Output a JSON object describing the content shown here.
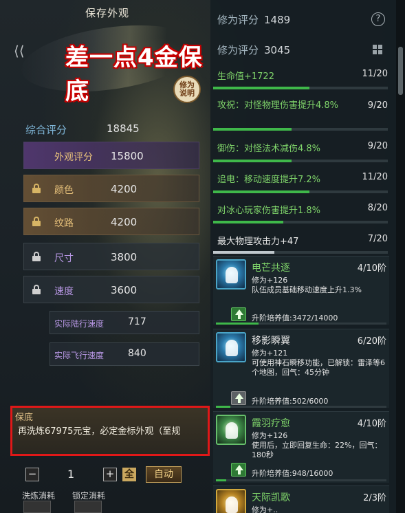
{
  "header": {
    "title": "保存外观"
  },
  "overlay": {
    "banner": "差一点4金保底"
  },
  "explain_badge": "修为\n说明",
  "summary": {
    "label": "综合评分",
    "value": "18845"
  },
  "appearance": {
    "label": "外观评分",
    "value": "15800"
  },
  "attributes": [
    {
      "label": "颜色",
      "value": "4200",
      "locked": true
    },
    {
      "label": "纹路",
      "value": "4200",
      "locked": true
    },
    {
      "label": "尺寸",
      "value": "3800",
      "locked": false
    },
    {
      "label": "速度",
      "value": "3600",
      "locked": false
    }
  ],
  "speeds": [
    {
      "label": "实际陆行速度",
      "value": "717"
    },
    {
      "label": "实际飞行速度",
      "value": "840"
    }
  ],
  "guarantee": {
    "title": "保底",
    "text": "再洗炼67975元宝，必定金标外观（至规"
  },
  "controls": {
    "quantity": "1",
    "minus": "−",
    "plus": "+",
    "all_label": "全",
    "auto_label": "自动",
    "wash_cost_label": "洗炼消耗",
    "lock_cost_label": "锁定消耗"
  },
  "cultivation": {
    "label": "修为评分",
    "value": "1489",
    "help": "?"
  },
  "cultivation2": {
    "label": "修为评分",
    "value": "3045"
  },
  "stats": [
    {
      "name": "生命值+1722",
      "level": "11/20",
      "fill": 0.55
    },
    {
      "name": "攻祝：对怪物理伤害提升4.8%",
      "level": "9/20",
      "fill": 0.45
    },
    {
      "name": "御伤：对怪法术减伤4.8%",
      "level": "9/20",
      "fill": 0.45
    },
    {
      "name": "追电：移动速度提升7.2%",
      "level": "11/20",
      "fill": 0.55
    },
    {
      "name": "对冰心玩家伤害提升1.8%",
      "level": "8/20",
      "fill": 0.4
    },
    {
      "name": "最大物理攻击力+47",
      "level": "7/20",
      "fill": 0.35
    }
  ],
  "skills": [
    {
      "name": "电芒共逐",
      "level": "4/10阶",
      "line1": "修为+126",
      "line2": "队伍成员基础移动速度上升1.3%",
      "line3": "",
      "upgrade": "升阶培养值:3472/14000",
      "fill": 0.248,
      "icon": "lightning-runner-icon"
    },
    {
      "name": "移影瞬翼",
      "level": "6/20阶",
      "line1": "修为+121",
      "line2": "可使用神石瞬移功能，已解锁：雷泽等6个地图，回气：45分钟",
      "line3": "",
      "upgrade": "升阶培养值:502/6000",
      "fill": 0.084,
      "icon": "teleport-wing-icon"
    },
    {
      "name": "霞羽疗愈",
      "level": "4/10阶",
      "line1": "修为+126",
      "line2": "使用后，立即回复生命：22%，回气：180秒",
      "line3": "",
      "upgrade": "升阶培养值:948/16000",
      "fill": 0.059,
      "icon": "healing-feather-icon"
    },
    {
      "name": "天际凯歌",
      "level": "2/3阶",
      "line1": "修为+..",
      "line2": "",
      "line3": "",
      "upgrade": "",
      "fill": 0,
      "icon": "sky-song-icon"
    }
  ]
}
